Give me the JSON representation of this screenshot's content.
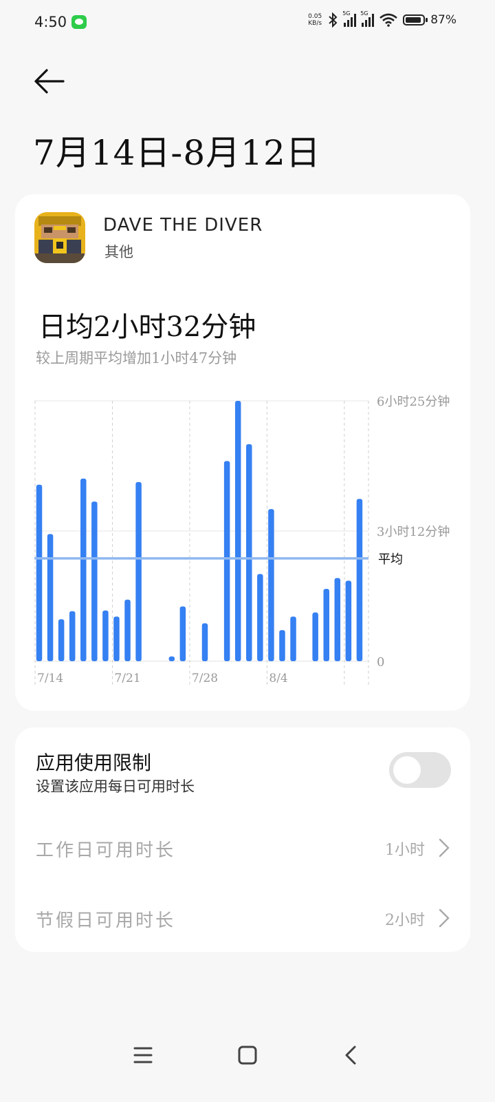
{
  "status_bar": {
    "time": "4:50",
    "net_speed": "0.05",
    "net_unit": "KB/s",
    "signal1": "5G",
    "signal2": "5G",
    "battery": "87%"
  },
  "page": {
    "title": "7月14日-8月12日"
  },
  "app": {
    "name": "DAVE THE DIVER",
    "category": "其他",
    "daily_average": "日均2小时32分钟",
    "comparison": "较上周期平均增加1小时47分钟"
  },
  "chart_data": {
    "type": "bar",
    "y_unit": "minutes",
    "y_tick_labels": [
      "6小时25分钟",
      "3小时12分钟",
      "0"
    ],
    "x_tick_labels": [
      "7/14",
      "7/21",
      "7/28",
      "8/4"
    ],
    "average_label": "平均",
    "average_minutes": 152,
    "ylim": [
      0,
      385
    ],
    "categories": [
      "7/14",
      "7/15",
      "7/16",
      "7/17",
      "7/18",
      "7/19",
      "7/20",
      "7/21",
      "7/22",
      "7/23",
      "7/24",
      "7/25",
      "7/26",
      "7/27",
      "7/28",
      "7/29",
      "7/30",
      "7/31",
      "8/1",
      "8/2",
      "8/3",
      "8/4",
      "8/5",
      "8/6",
      "8/7",
      "8/8",
      "8/9",
      "8/10",
      "8/11",
      "8/12"
    ],
    "values": [
      261,
      188,
      62,
      74,
      270,
      236,
      75,
      66,
      91,
      265,
      0,
      0,
      7,
      81,
      0,
      56,
      0,
      296,
      385,
      321,
      129,
      225,
      46,
      66,
      0,
      72,
      107,
      123,
      119,
      240
    ],
    "color": "#3580f2",
    "average_color": "#8fb8f0"
  },
  "limits": {
    "title": "应用使用限制",
    "subtitle": "设置该应用每日可用时长",
    "toggle_on": false,
    "workday_label": "工作日可用时长",
    "workday_value": "1小时",
    "holiday_label": "节假日可用时长",
    "holiday_value": "2小时"
  },
  "icons": {
    "back": "back-arrow-icon",
    "menu": "menu-icon",
    "home": "home-icon",
    "nav_back": "nav-back-icon"
  }
}
